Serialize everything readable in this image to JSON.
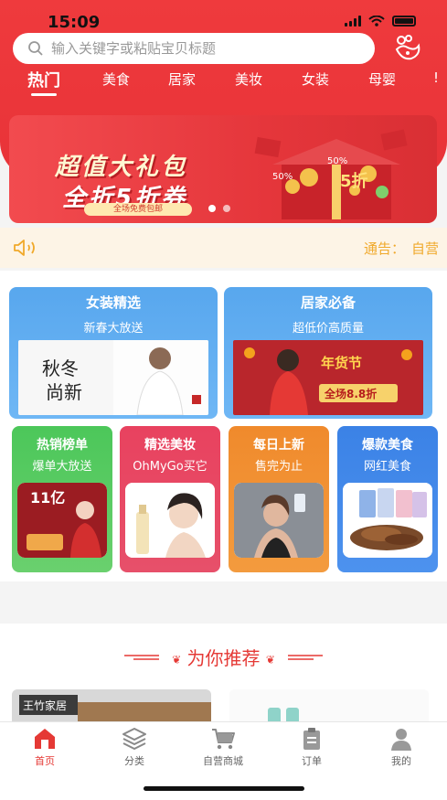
{
  "status_bar": {
    "time": "15:09"
  },
  "search": {
    "placeholder": "输入关键字或粘贴宝贝标题"
  },
  "tabs": [
    "热门",
    "美食",
    "居家",
    "美妆",
    "女装",
    "母婴",
    "!"
  ],
  "banner": {
    "title": "超值大礼包",
    "subtitle": "全折5折券",
    "note": "全场免费包邮",
    "badge": "50%",
    "badge2": "50%",
    "coupon_text": "5折"
  },
  "notice": {
    "label": "通告：",
    "text": "自营"
  },
  "cards_big": [
    {
      "title": "女装精选",
      "subtitle": "新春大放送",
      "img_text1": "秋冬",
      "img_text2": "尚新"
    },
    {
      "title": "居家必备",
      "subtitle": "超低价高质量",
      "img_text1": "年货节",
      "img_text2": "全场8.8折"
    }
  ],
  "cards_small": [
    {
      "title": "热销榜单",
      "subtitle": "爆单大放送",
      "img_text": "11亿"
    },
    {
      "title": "精选美妆",
      "subtitle": "OhMyGo买它"
    },
    {
      "title": "每日上新",
      "subtitle": "售完为止"
    },
    {
      "title": "爆款美食",
      "subtitle": "网红美食"
    }
  ],
  "recommend": {
    "title": "为你推荐",
    "item1_text": "王竹家居"
  },
  "bottom_nav": [
    {
      "label": "首页"
    },
    {
      "label": "分类"
    },
    {
      "label": "自营商城"
    },
    {
      "label": "订单"
    },
    {
      "label": "我的"
    }
  ],
  "colors": {
    "primary": "#e53935",
    "notice": "#f0a92b",
    "blue": "#58a7ee",
    "green": "#5cc85f",
    "pink": "#e8425f",
    "orange": "#f08a2c",
    "blue2": "#3b82e6"
  }
}
